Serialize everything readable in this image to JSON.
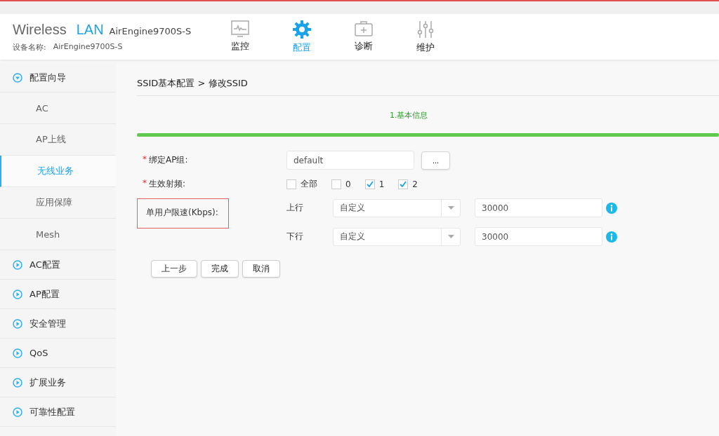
{
  "header": {
    "brand_word": "Wireless",
    "brand_accent": "LAN",
    "model": "AirEngine9700S-S",
    "device_label": "设备名称:",
    "device_name": "AirEngine9700S-S"
  },
  "nav": [
    {
      "kind": "monitor",
      "label": "监控",
      "selected": false
    },
    {
      "kind": "config",
      "label": "配置",
      "selected": true
    },
    {
      "kind": "diagnose",
      "label": "诊断",
      "selected": false
    },
    {
      "kind": "maintain",
      "label": "维护",
      "selected": false
    }
  ],
  "sidebar": [
    {
      "label": "配置向导",
      "expanded": true,
      "children": [
        {
          "label": "AC",
          "selected": false
        },
        {
          "label": "AP上线",
          "selected": false
        },
        {
          "label": "无线业务",
          "selected": true
        },
        {
          "label": "应用保障",
          "selected": false
        },
        {
          "label": "Mesh",
          "selected": false
        }
      ]
    },
    {
      "label": "AC配置",
      "expanded": false
    },
    {
      "label": "AP配置",
      "expanded": false
    },
    {
      "label": "安全管理",
      "expanded": false
    },
    {
      "label": "QoS",
      "expanded": false
    },
    {
      "label": "扩展业务",
      "expanded": false
    },
    {
      "label": "可靠性配置",
      "expanded": false
    }
  ],
  "breadcrumb": "SSID基本配置 > 修改SSID",
  "step": {
    "label": "1.基本信息",
    "level": 1
  },
  "ap_group": {
    "label": "绑定AP组:",
    "required_mark": "*",
    "value": "default",
    "browse": "..."
  },
  "radio": {
    "label": "生效射频:",
    "required_mark": "*",
    "options": [
      {
        "label": "全部",
        "checked": false
      },
      {
        "label": "0",
        "checked": false
      },
      {
        "label": "1",
        "checked": true
      },
      {
        "label": "2",
        "checked": true
      }
    ]
  },
  "rate_limit": {
    "label": "单用户限速(Kbps):",
    "highlighted": true,
    "rows": [
      {
        "direction": "上行",
        "mode": "自定义",
        "value": "30000"
      },
      {
        "direction": "下行",
        "mode": "自定义",
        "value": "30000"
      }
    ]
  },
  "buttons": [
    "上一步",
    "完成",
    "取消"
  ]
}
